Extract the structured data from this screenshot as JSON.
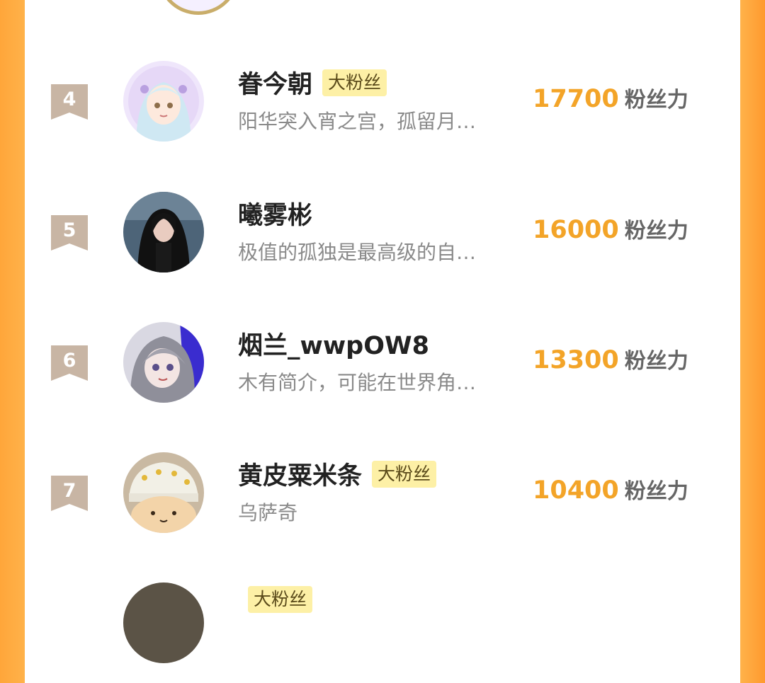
{
  "unit_label": "粉丝力",
  "badge_label": "大粉丝",
  "rows": [
    {
      "rank": "4",
      "name": "眷今朝",
      "has_badge": true,
      "bio": "阳华突入宵之宫，孤留月…",
      "score": "17700"
    },
    {
      "rank": "5",
      "name": "曦雾彬",
      "has_badge": false,
      "bio": "极值的孤独是最高级的自…",
      "score": "16000"
    },
    {
      "rank": "6",
      "name": "烟兰_wwpOW8",
      "has_badge": false,
      "bio": "木有简介，可能在世界角…",
      "score": "13300"
    },
    {
      "rank": "7",
      "name": "黄皮粟米条",
      "has_badge": true,
      "bio": "乌萨奇",
      "score": "10400"
    },
    {
      "rank": "",
      "name": "",
      "has_badge": true,
      "bio": "",
      "score": ""
    }
  ]
}
